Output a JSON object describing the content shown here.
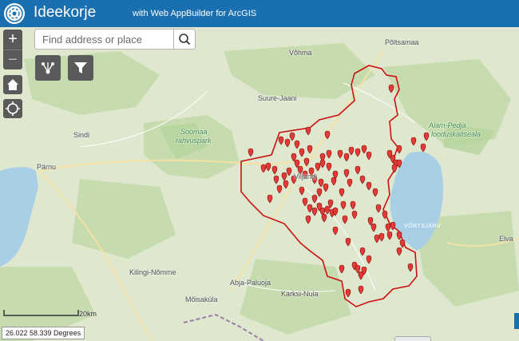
{
  "header": {
    "title": "Ideekorje",
    "subtitle": "with Web AppBuilder for ArcGIS",
    "logo_icon": "globe-logo-icon",
    "color": "#1a6fb0"
  },
  "search": {
    "placeholder": "Find address or place",
    "button_icon": "search-icon"
  },
  "controls": {
    "zoom_in_label": "+",
    "zoom_out_label": "−",
    "home_icon": "home-icon",
    "locate_icon": "locate-icon",
    "share_icon": "share-network-icon",
    "filter_icon": "filter-icon"
  },
  "map": {
    "places": {
      "poltsamaa": "Põltsamaa",
      "vohma": "Võhma",
      "suure_jaani": "Suure-Jaani",
      "soomaa": "Soomaa",
      "rahvuspark": "rahvuspark",
      "alam_pedja": "Alam-Pedja",
      "looduskaitseala": "looduskaitseala",
      "sindi": "Sindi",
      "parnu": "Pärnu",
      "viljandi": "Viljandi",
      "vortsjarv": "VÕRTSJÄRV",
      "kilingi": "Kilingi-Nõmme",
      "abja": "Abja-Paluoja",
      "karksi": "Karksi-Nuia",
      "elva": "Elva",
      "moisakula": "Mõisaküla"
    },
    "scale_label": "20km",
    "coordinates": "26.022 58.339 Degrees",
    "boundary_color": "#cc1111",
    "marker_color": "#e53935",
    "marker_count": 100
  }
}
